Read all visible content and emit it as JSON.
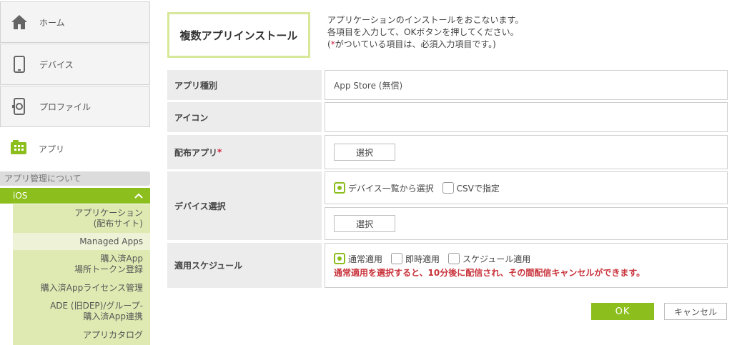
{
  "sidebar": {
    "items": [
      {
        "label": "ホーム",
        "icon": "home-icon"
      },
      {
        "label": "デバイス",
        "icon": "device-icon"
      },
      {
        "label": "プロファイル",
        "icon": "profile-icon"
      },
      {
        "label": "アプリ",
        "icon": "app-icon"
      }
    ],
    "about": "アプリ管理について",
    "ios": {
      "label": "iOS",
      "chevron": "^",
      "items": [
        {
          "label": "アプリケーション\n(配布サイト)"
        },
        {
          "label": "Managed Apps"
        },
        {
          "label": "購入済App\n場所トークン登録"
        },
        {
          "label": "購入済Appライセンス管理"
        },
        {
          "label": "ADE (旧DEP)/グループ-\n購入済App連携"
        },
        {
          "label": "アプリカタログ"
        }
      ]
    }
  },
  "main": {
    "title": "複数アプリインストール",
    "desc": {
      "line1": "アプリケーションのインストールをおこないます。",
      "line2": "各項目を入力して、OKボタンを押してください。",
      "line3_open": "(",
      "line3_star": "*",
      "line3_rest": "がついている項目は、必須入力項目です。)"
    },
    "rows": {
      "app_type": {
        "label": "アプリ種別",
        "value": "App Store (無償)"
      },
      "icon": {
        "label": "アイコン"
      },
      "dist_app": {
        "label": "配布アプリ",
        "star": "*",
        "button": "選択"
      },
      "device_select": {
        "label": "デバイス選択",
        "opt1": "デバイス一覧から選択",
        "opt2": "CSVで指定",
        "button": "選択"
      },
      "schedule": {
        "label": "適用スケジュール",
        "opt1": "通常適用",
        "opt2": "即時適用",
        "opt3": "スケジュール適用",
        "note": "通常適用を選択すると、10分後に配信され、その間配信キャンセルができます。"
      }
    },
    "ok": "OK",
    "cancel": "キャンセル"
  },
  "colors": {
    "accent": "#8cbf1e",
    "warning": "#c8323a",
    "required": "#d0203a"
  }
}
